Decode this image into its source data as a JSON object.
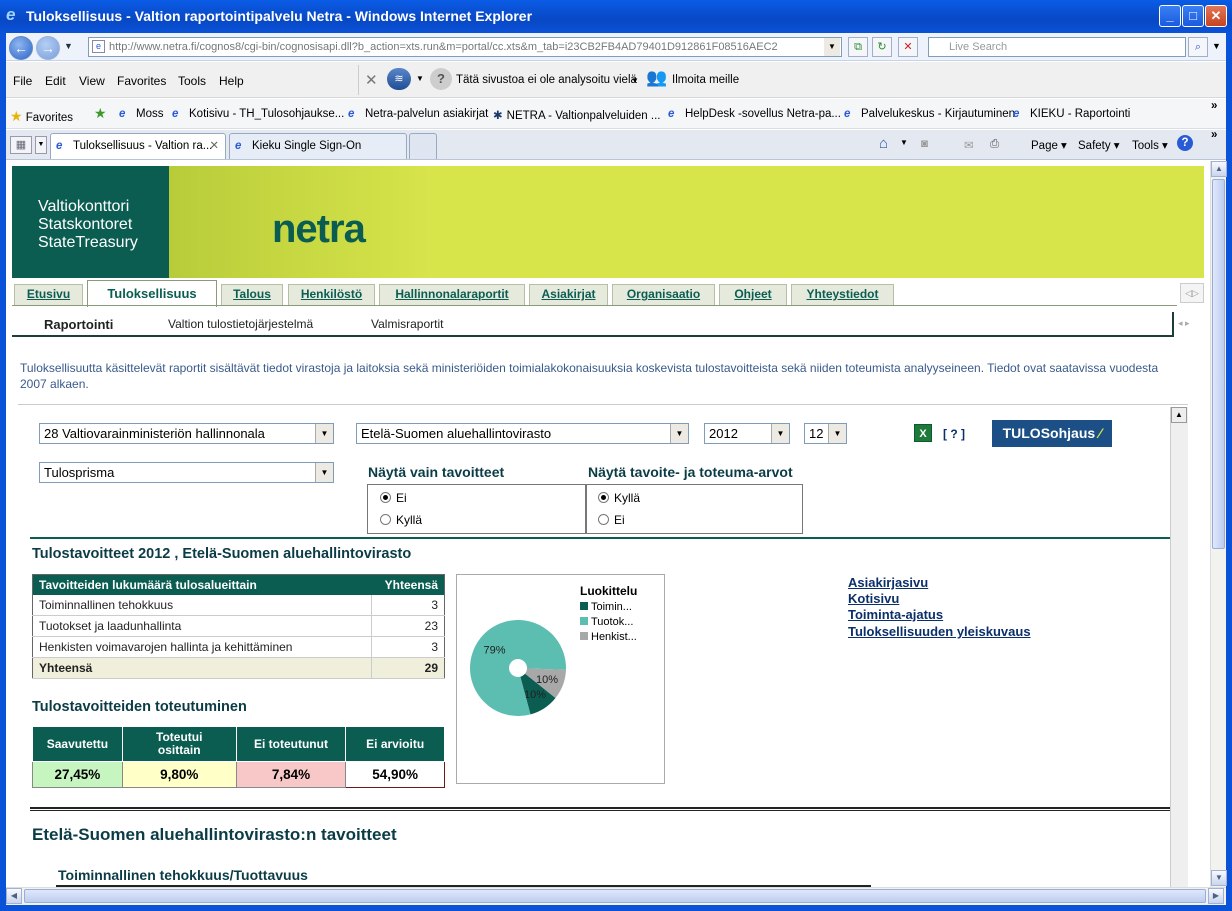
{
  "window": {
    "title": "Tuloksellisuus - Valtion raportointipalvelu Netra - Windows Internet Explorer"
  },
  "address": {
    "url": "http://www.netra.fi/cognos8/cgi-bin/cognosisapi.dll?b_action=xts.run&m=portal/cc.xts&m_tab=i23CB2FB4AD79401D912861F08516AEC2",
    "search_placeholder": "Live Search"
  },
  "menu": {
    "items": [
      "File",
      "Edit",
      "View",
      "Favorites",
      "Tools",
      "Help"
    ],
    "phishing": "Tätä sivustoa ei ole analysoitu vielä",
    "report": "Ilmoita meille"
  },
  "favorites": {
    "label": "Favorites",
    "links": [
      "Moss",
      "Kotisivu - TH_Tulosohjaukse...",
      "Netra-palvelun asiakirjat",
      "NETRA - Valtionpalveluiden ...",
      "HelpDesk -sovellus Netra-pa...",
      "Palvelukeskus - Kirjautuminen",
      "KIEKU - Raportointi"
    ]
  },
  "browser_tabs": [
    "Tuloksellisuus - Valtion ra...",
    "Kieku Single Sign-On"
  ],
  "command_bar": {
    "page": "Page",
    "safety": "Safety",
    "tools": "Tools"
  },
  "banner": {
    "org_lines": [
      "Valtiokonttori",
      "Statskontoret",
      "StateTreasury"
    ],
    "brand": "netra"
  },
  "tabs": [
    "Etusivu",
    "Tuloksellisuus",
    "Talous",
    "Henkilöstö",
    "Hallinnonalaraportit",
    "Asiakirjat",
    "Organisaatio",
    "Ohjeet",
    "Yhteystiedot"
  ],
  "subnav": [
    "Raportointi",
    "Valtion tulostietojärjestelmä",
    "Valmisraportit"
  ],
  "intro": "Tuloksellisuutta käsittelevät raportit sisältävät tiedot virastoja ja laitoksia sekä ministeriöiden toimialakokonaisuuksia koskevista tulostavoitteista sekä niiden toteumista analyyseineen. Tiedot ovat saatavissa vuodesta 2007 alkaen.",
  "filters": {
    "hallinnonala": "28 Valtiovarainministeriön hallinnonala",
    "virasto": "Etelä-Suomen aluehallintovirasto",
    "year": "2012",
    "month": "12",
    "report": "Tulosprisma",
    "help": "[ ? ]",
    "logo": "TULOSohjaus"
  },
  "options": {
    "only_targets": {
      "label": "Näytä vain tavoitteet",
      "choices": [
        "Ei",
        "Kyllä"
      ],
      "selected": "Ei"
    },
    "show_values": {
      "label": "Näytä tavoite- ja toteuma-arvot",
      "choices": [
        "Kyllä",
        "Ei"
      ],
      "selected": "Kyllä"
    }
  },
  "section_title": "Tulostavoitteet 2012 , Etelä-Suomen aluehallintovirasto",
  "count_table": {
    "headers": [
      "Tavoitteiden lukumäärä tulosalueittain",
      "Yhteensä"
    ],
    "rows": [
      {
        "name": "Toiminnallinen tehokkuus",
        "value": "3"
      },
      {
        "name": "Tuotokset ja laadunhallinta",
        "value": "23"
      },
      {
        "name": "Henkisten voimavarojen hallinta ja kehittäminen",
        "value": "3"
      }
    ],
    "total": {
      "name": "Yhteensä",
      "value": "29"
    }
  },
  "realization": {
    "title": "Tulostavoitteiden toteutuminen",
    "headers": [
      "Saavutettu",
      "Toteutui osittain",
      "Ei toteutunut",
      "Ei arvioitu"
    ],
    "values": [
      "27,45%",
      "9,80%",
      "7,84%",
      "54,90%"
    ],
    "colors": [
      "#c6f5c0",
      "#ffffc8",
      "#f8c8c8",
      "#ffffff"
    ]
  },
  "chart_data": {
    "type": "pie",
    "legend_title": "Luokittelu",
    "categories": [
      "Toimin...",
      "Tuotok...",
      "Henkist..."
    ],
    "values": [
      10,
      79,
      10
    ],
    "labels": [
      "10%",
      "79%",
      "10%"
    ],
    "colors": [
      "#0b5d52",
      "#5cbdb1",
      "#a8a8a8"
    ],
    "legend": "top-right"
  },
  "links": [
    "Asiakirjasivu",
    "Kotisivu",
    "Toiminta-ajatus",
    "Tuloksellisuuden yleiskuvaus"
  ],
  "goals_heading": "Etelä-Suomen aluehallintovirasto:n tavoitteet",
  "goals_subheading": "Toiminnallinen tehokkuus/Tuottavuus"
}
